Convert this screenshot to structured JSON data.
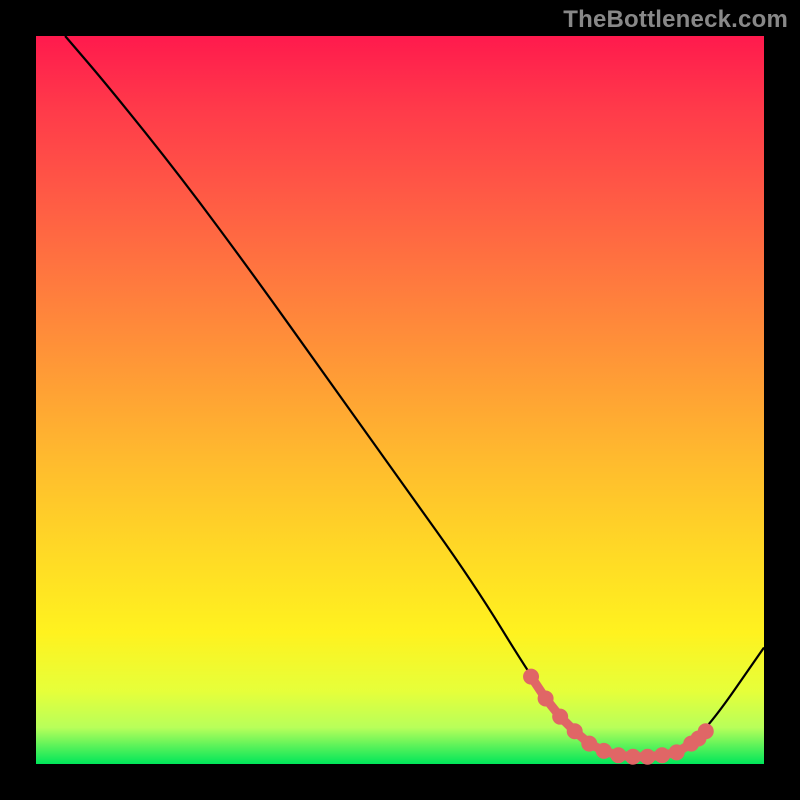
{
  "watermark": "TheBottleneck.com",
  "chart_data": {
    "type": "line",
    "title": "",
    "xlabel": "",
    "ylabel": "",
    "xlim": [
      0,
      100
    ],
    "ylim": [
      0,
      100
    ],
    "grid": false,
    "series": [
      {
        "name": "curve",
        "color": "#000000",
        "x": [
          4,
          10,
          20,
          30,
          40,
          50,
          60,
          68,
          72,
          76,
          80,
          84,
          88,
          92,
          100
        ],
        "y": [
          100,
          93,
          80.5,
          67,
          53,
          39,
          25,
          12,
          6.5,
          2.8,
          1.2,
          1.0,
          1.6,
          4.5,
          16
        ]
      }
    ],
    "highlight": {
      "name": "sweet-spot",
      "color": "#e06666",
      "x": [
        68,
        70,
        72,
        74,
        76,
        78,
        80,
        82,
        84,
        86,
        88,
        90,
        91,
        92
      ],
      "y": [
        12,
        9,
        6.5,
        4.5,
        2.8,
        1.8,
        1.2,
        1.0,
        1.0,
        1.2,
        1.6,
        2.8,
        3.5,
        4.5
      ]
    },
    "background": "rainbow-vertical"
  }
}
